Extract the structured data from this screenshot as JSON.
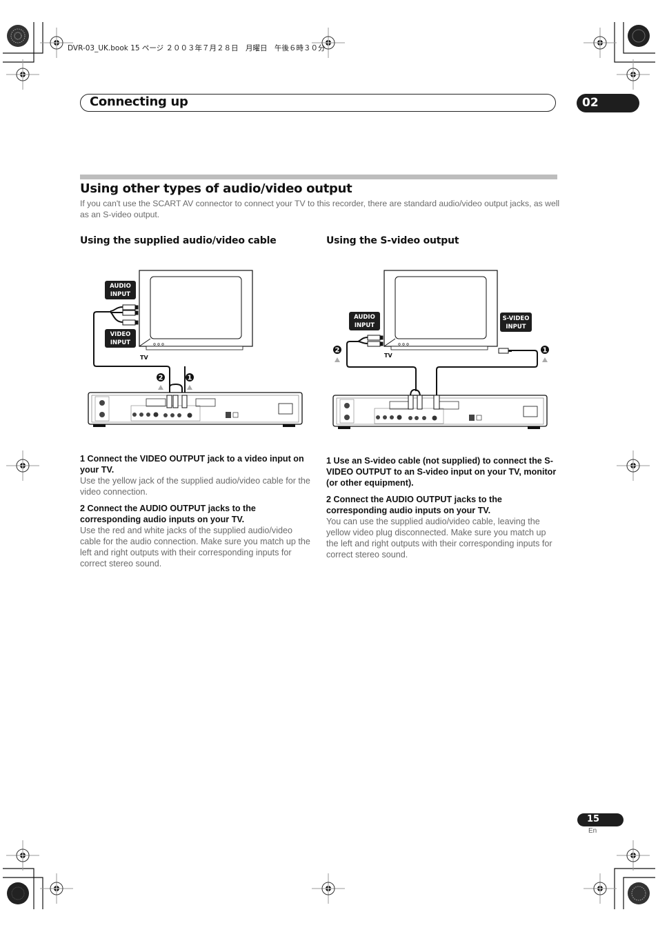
{
  "print_header": {
    "text": "DVR-03_UK.book  15 ページ  ２００３年７月２８日　月曜日　午後６時３０分"
  },
  "chapter": {
    "title": "Connecting up",
    "number": "02"
  },
  "section": {
    "title": "Using other types of audio/video output",
    "intro": "If you can't use the SCART AV connector to connect your TV to this recorder, there are standard audio/video output jacks, as well as an S-video output."
  },
  "left_column": {
    "title": "Using the supplied audio/video cable",
    "diagram": {
      "labels": {
        "audio_input": [
          "AUDIO",
          "INPUT"
        ],
        "video_input": [
          "VIDEO",
          "INPUT"
        ],
        "tv": "TV",
        "callout_1": "1",
        "callout_2": "2"
      }
    },
    "steps": [
      {
        "heading": "1    Connect the VIDEO OUTPUT jack to a video input on your TV.",
        "body": "Use the yellow jack of the supplied audio/video cable for the video connection."
      },
      {
        "heading": "2    Connect the AUDIO OUTPUT jacks to the corresponding audio inputs on your TV.",
        "body": "Use the red and white jacks of the supplied audio/video cable for the audio connection. Make sure you match up the left and right outputs with their corresponding inputs for correct stereo sound."
      }
    ]
  },
  "right_column": {
    "title": "Using the S-video output",
    "diagram": {
      "labels": {
        "audio_input": [
          "AUDIO",
          "INPUT"
        ],
        "svideo_input": [
          "S-VIDEO",
          "INPUT"
        ],
        "tv": "TV",
        "callout_1": "1",
        "callout_2": "2"
      }
    },
    "steps": [
      {
        "heading": "1    Use an S-video cable (not supplied) to connect the S-VIDEO OUTPUT to an S-video input on your TV, monitor (or other equipment).",
        "body": ""
      },
      {
        "heading": "2    Connect the AUDIO OUTPUT jacks to the corresponding audio inputs on your TV.",
        "body": "You can use the supplied audio/video cable, leaving the yellow video plug disconnected. Make sure you match up the left and right outputs with their corresponding inputs for correct stereo sound."
      }
    ]
  },
  "footer": {
    "page_number": "15",
    "language": "En"
  }
}
